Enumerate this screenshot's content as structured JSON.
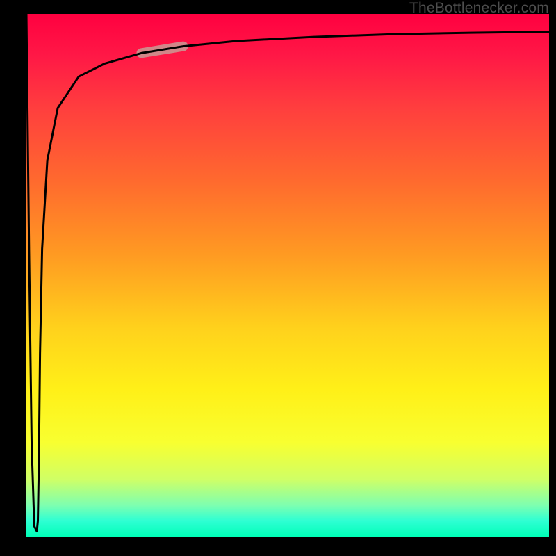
{
  "attribution": "TheBottlenecker.com",
  "chart_data": {
    "type": "line",
    "title": "",
    "xlabel": "",
    "ylabel": "",
    "xlim": [
      0,
      100
    ],
    "ylim": [
      0,
      100
    ],
    "axes_visible": false,
    "gradient": "vertical red→orange→yellow→green (top→bottom)",
    "series": [
      {
        "name": "bottleneck-curve",
        "x": [
          0,
          0.5,
          1.0,
          1.5,
          2.0,
          2.2,
          2.4,
          2.6,
          3.0,
          4.0,
          6.0,
          10.0,
          15.0,
          22.0,
          30.0,
          40.0,
          55.0,
          70.0,
          85.0,
          100.0
        ],
        "y": [
          100,
          55,
          18,
          2,
          1,
          3,
          15,
          35,
          55,
          72,
          82,
          88,
          90.5,
          92.5,
          93.8,
          94.8,
          95.6,
          96.1,
          96.4,
          96.6
        ]
      },
      {
        "name": "highlight-segment",
        "x": [
          22.0,
          30.0
        ],
        "y": [
          92.5,
          93.8
        ]
      }
    ],
    "colors": {
      "line": "#000000",
      "highlight": "#cf8d8d"
    }
  }
}
